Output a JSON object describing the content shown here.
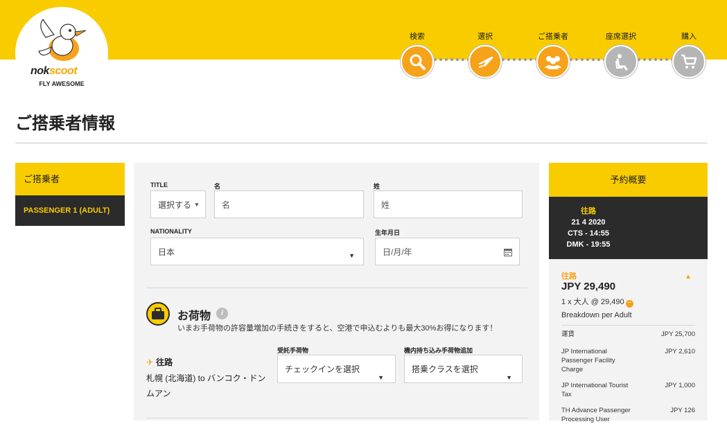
{
  "header": {
    "logo_nok": "nok",
    "logo_scoot": "scoot",
    "tagline": "FLY AWESOME",
    "colors": {
      "brand_yellow": "#f9cc00",
      "step_active": "#f7a21b",
      "step_inactive": "#b5b5b5",
      "dark": "#2b2b2b"
    },
    "steps": [
      {
        "label": "検索",
        "icon": "search-icon",
        "state": "active"
      },
      {
        "label": "選択",
        "icon": "airplane-icon",
        "state": "active"
      },
      {
        "label": "ご搭乗者",
        "icon": "passengers-icon",
        "state": "active"
      },
      {
        "label": "座席選択",
        "icon": "seat-icon",
        "state": "inactive"
      },
      {
        "label": "購入",
        "icon": "cart-icon",
        "state": "inactive"
      }
    ]
  },
  "page": {
    "title": "ご搭乗者情報"
  },
  "leftnav": {
    "heading": "ご搭乗者",
    "items": [
      {
        "label": "PASSENGER 1 (ADULT)"
      }
    ]
  },
  "form": {
    "title_label": "TITLE",
    "title_value": "選択する",
    "first_name_label": "名",
    "first_name_placeholder": "名",
    "last_name_label": "姓",
    "last_name_placeholder": "姓",
    "nationality_label": "NATIONALITY",
    "nationality_value": "日本",
    "dob_label": "生年月日",
    "dob_placeholder": "日/月/年",
    "baggage": {
      "title": "お荷物",
      "info": "i",
      "note": "いまお手荷物の許容量増加の手続きをすると、空港で申込むよりも最大30%お得になります！",
      "outbound_label": "往路",
      "route": "札幌 (北海道) to バンコク・ドンムアン",
      "checked_label": "受託手荷物",
      "checked_value": "チェックインを選択",
      "cabin_label": "機内持ち込み手荷物追加",
      "cabin_value": "搭乗クラスを選択"
    }
  },
  "summary": {
    "heading": "予約概要",
    "flight": {
      "direction": "往路",
      "date": "21 4 2020",
      "depart": "CTS - 14:55",
      "arrive": "DMK - 19:55"
    },
    "outbound_label": "往路",
    "total": "JPY 29,490",
    "pax_line": "1 x 大人 @ 29,490",
    "breakdown_label": "Breakdown per Adult",
    "fees": [
      {
        "name": "運賃",
        "amount": "JPY 25,700"
      },
      {
        "name": "JP International Passenger Facility Charge",
        "amount": "JPY 2,610"
      },
      {
        "name": "JP International Tourist Tax",
        "amount": "JPY 1,000"
      },
      {
        "name": "TH Advance Passenger Processing User",
        "amount": "JPY 126"
      }
    ]
  }
}
